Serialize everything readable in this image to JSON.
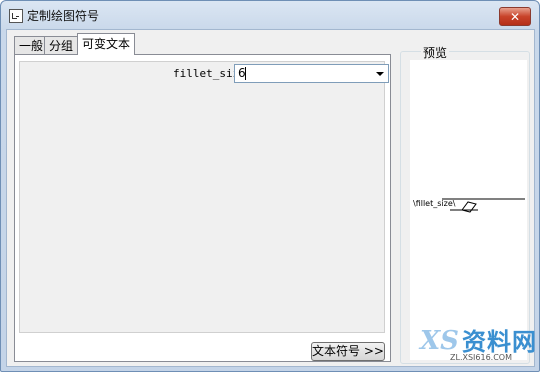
{
  "window": {
    "title": "定制绘图符号",
    "close_label": "✕"
  },
  "tabs": [
    {
      "label": "一般"
    },
    {
      "label": "分组"
    },
    {
      "label": "可变文本"
    }
  ],
  "variable_text": {
    "field_label": "fillet_size",
    "field_value": "6",
    "text_symbol_button": "文本符号 >>"
  },
  "preview": {
    "label": "预览",
    "symbol_text": "\\fillet_size\\"
  },
  "watermark": {
    "brand": "资料网",
    "logo_text": "XS",
    "url": "ZL.XSI616.COM"
  }
}
